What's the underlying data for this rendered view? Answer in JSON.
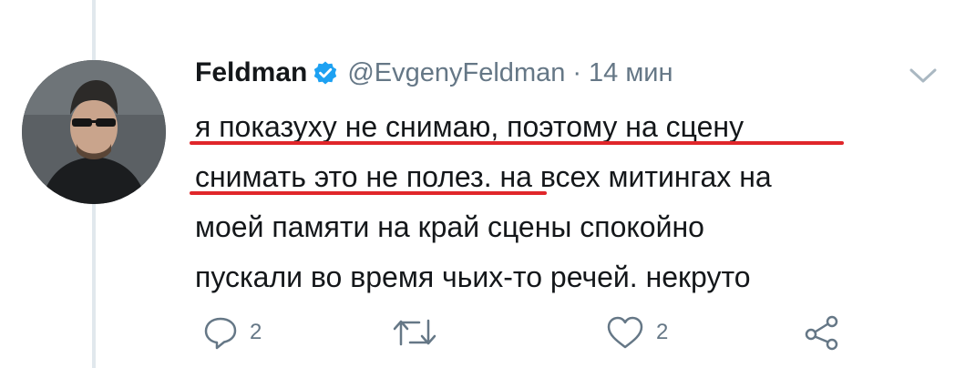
{
  "tweet": {
    "author_name": "Feldman",
    "handle": "@EvgenyFeldman",
    "separator": "·",
    "time": "14 мин",
    "lines": [
      "я показуху не снимаю, поэтому на сцену",
      "снимать это не полез. на всех митингах на",
      "моей памяти на край сцены спокойно",
      "пускали во время чьих-то речей. некруто"
    ]
  },
  "actions": {
    "reply_count": "2",
    "like_count": "2"
  },
  "colors": {
    "verified_badge": "#1da1f2",
    "underline": "#e0262a",
    "secondary_text": "#657786"
  },
  "icons": [
    "avatar",
    "verified-badge-icon",
    "chevron-down-icon",
    "reply-icon",
    "retweet-icon",
    "like-icon",
    "share-icon"
  ]
}
